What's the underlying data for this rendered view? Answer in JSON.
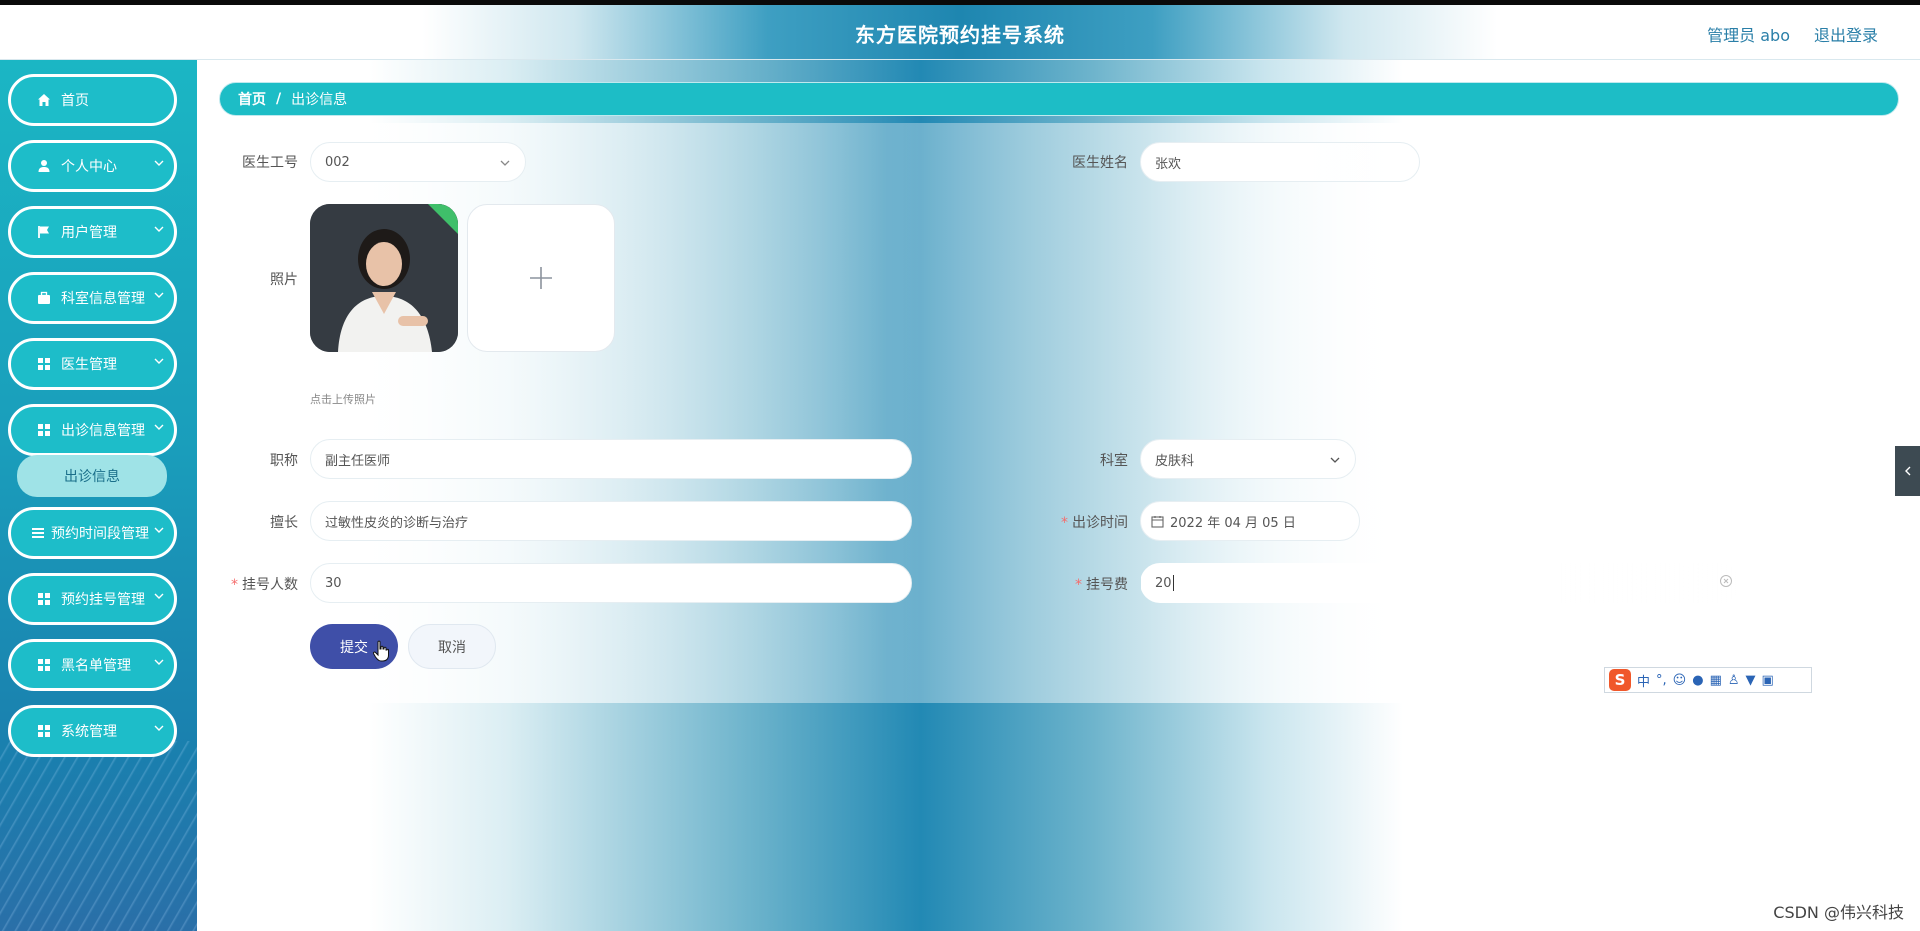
{
  "header": {
    "title": "东方医院预约挂号系统",
    "user": "管理员 abo",
    "logout": "退出登录"
  },
  "sidebar": {
    "items": [
      {
        "label": "首页",
        "icon": "home-icon",
        "expandable": false
      },
      {
        "label": "个人中心",
        "icon": "user-icon",
        "expandable": true
      },
      {
        "label": "用户管理",
        "icon": "flag-icon",
        "expandable": true
      },
      {
        "label": "科室信息管理",
        "icon": "briefcase-icon",
        "expandable": true
      },
      {
        "label": "医生管理",
        "icon": "grid-icon",
        "expandable": true
      },
      {
        "label": "出诊信息管理",
        "icon": "grid-icon",
        "expandable": true
      },
      {
        "label": "预约时间段管理",
        "icon": "list-icon",
        "expandable": true
      },
      {
        "label": "预约挂号管理",
        "icon": "grid-icon",
        "expandable": true
      },
      {
        "label": "黑名单管理",
        "icon": "grid-icon",
        "expandable": true
      },
      {
        "label": "系统管理",
        "icon": "grid-icon",
        "expandable": true
      }
    ],
    "submenu": {
      "label": "出诊信息"
    }
  },
  "breadcrumb": {
    "home": "首页",
    "separator": "/",
    "current": "出诊信息"
  },
  "form": {
    "doctor_id": {
      "label": "医生工号",
      "value": "002"
    },
    "doctor_name": {
      "label": "医生姓名",
      "value": "张欢"
    },
    "photo": {
      "label": "照片",
      "hint": "点击上传照片"
    },
    "title": {
      "label": "职称",
      "value": "副主任医师"
    },
    "department": {
      "label": "科室",
      "value": "皮肤科"
    },
    "specialty": {
      "label": "擅长",
      "value": "过敏性皮炎的诊断与治疗"
    },
    "visit_time": {
      "label": "出诊时间",
      "value": "2022 年 04 月 05 日",
      "required": true
    },
    "quota": {
      "label": "挂号人数",
      "value": "30",
      "required": true
    },
    "fee": {
      "label": "挂号费",
      "value": "20",
      "required": true
    },
    "submit": "提交",
    "cancel": "取消"
  },
  "ime": {
    "logo": "S",
    "lang": "中",
    "punct": "°,"
  },
  "watermark": "CSDN @伟兴科技",
  "colors": {
    "accent": "#1dbdc6",
    "submit": "#3f4fa8",
    "required": "#f56c6c",
    "header_text": "#2a7fa8"
  }
}
